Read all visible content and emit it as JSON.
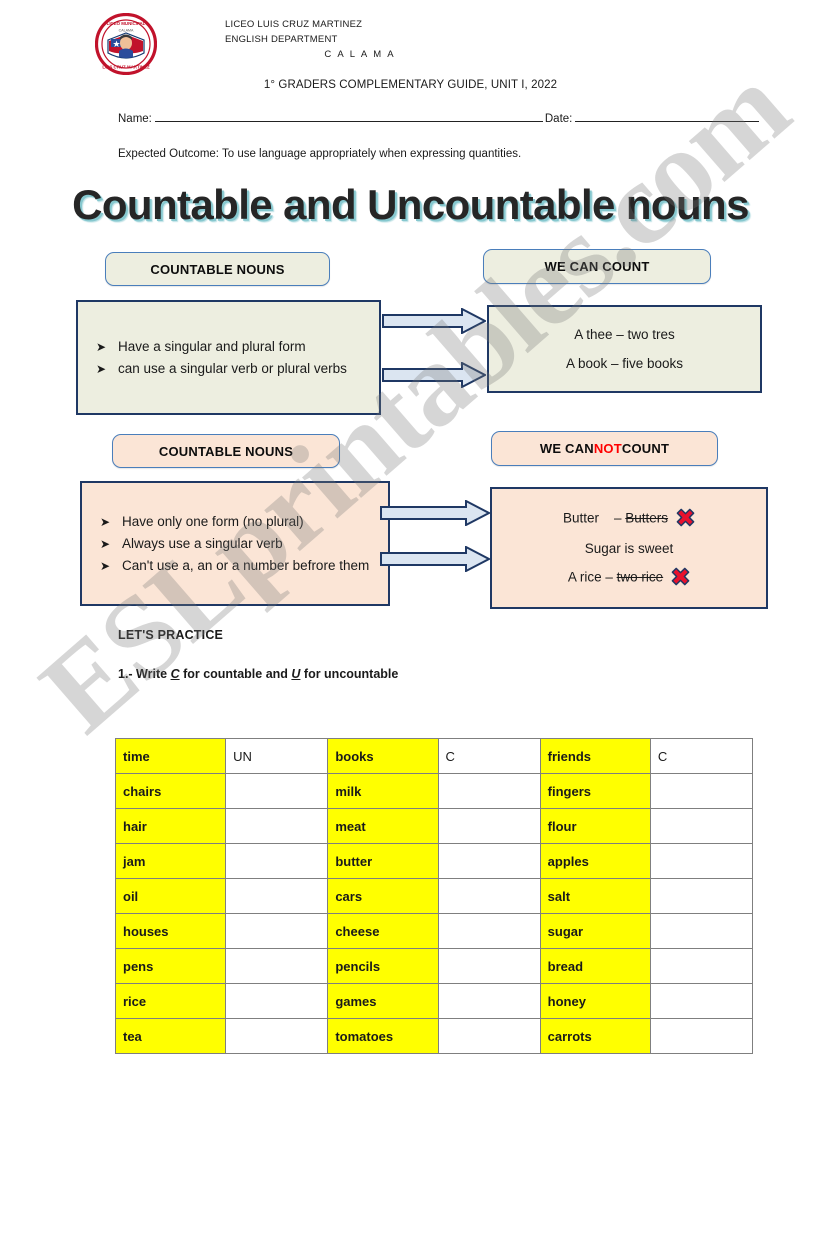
{
  "header": {
    "crest_icon": "school-crest-icon",
    "school_lines": [
      "LICEO LUIS CRUZ MARTINEZ",
      "ENGLISH DEPARTMENT",
      "C A L A M A"
    ],
    "guide_title": "1° GRADERS COMPLEMENTARY GUIDE, UNIT I, 2022",
    "name_label": "Name:",
    "date_label": "Date:",
    "name_value": "",
    "date_value": "",
    "expected_outcome": "Expected Outcome: To use language appropriately when expressing quantities."
  },
  "main_title": "Countable and Uncountable nouns",
  "diagram": {
    "row1": {
      "left_pill": "COUNTABLE NOUNS",
      "left_bullets": [
        "Have a singular and plural form",
        "can use a singular verb or plural verbs"
      ],
      "right_pill": "WE CAN COUNT",
      "right_lines": [
        "A thee – two tres",
        "A book – five books"
      ],
      "arrow_icon": "right-arrow-icon"
    },
    "row2": {
      "left_pill": "COUNTABLE NOUNS",
      "left_bullets": [
        "Have only one form (no plural)",
        "Always use a singular verb",
        "Can't use a, an or a number befrore them"
      ],
      "right_pill_pre": "WE CAN ",
      "right_pill_emphasis": "NOT",
      "right_pill_post": " COUNT",
      "right_line1_ok": "Butter",
      "right_line1_dash": "–",
      "right_line1_struck": "Butters",
      "right_line2": "Sugar is sweet",
      "right_line3_ok": "A rice –",
      "right_line3_struck": "two rice",
      "x_icon": "red-x-icon",
      "arrow_icon": "right-arrow-icon"
    }
  },
  "practice": {
    "heading": "LET'S PRACTICE",
    "instruction_pre": "1.- Write ",
    "instruction_c": "C",
    "instruction_mid": " for countable and ",
    "instruction_u": "U",
    "instruction_post": " for uncountable"
  },
  "table": {
    "rows": [
      {
        "w1": "time",
        "a1": "UN",
        "w2": "books",
        "a2": "C",
        "w3": "friends",
        "a3": "C"
      },
      {
        "w1": "chairs",
        "a1": "",
        "w2": "milk",
        "a2": "",
        "w3": "fingers",
        "a3": ""
      },
      {
        "w1": "hair",
        "a1": "",
        "w2": " meat",
        "a2": "",
        "w3": "flour",
        "a3": ""
      },
      {
        "w1": "jam",
        "a1": "",
        "w2": "butter",
        "a2": "",
        "w3": "apples",
        "a3": ""
      },
      {
        "w1": "oil",
        "a1": "",
        "w2": "cars",
        "a2": "",
        "w3": "salt",
        "a3": ""
      },
      {
        "w1": "houses",
        "a1": "",
        "w2": "cheese",
        "a2": "",
        "w3": "sugar",
        "a3": ""
      },
      {
        "w1": "pens",
        "a1": "",
        "w2": "pencils",
        "a2": "",
        "w3": "bread",
        "a3": ""
      },
      {
        "w1": "rice",
        "a1": "",
        "w2": "games",
        "a2": "",
        "w3": "honey",
        "a3": ""
      },
      {
        "w1": "tea",
        "a1": "",
        "w2": "tomatoes",
        "a2": "",
        "w3": "carrots",
        "a3": ""
      }
    ]
  },
  "watermark": {
    "text": "ESLprintables.com"
  },
  "colors": {
    "highlight_yellow": "#ffff00",
    "beige": "#edeee0",
    "peach": "#fbe5d6",
    "panel_border": "#1f3864",
    "pill_border": "#4a7ebb",
    "title_shadow": "#86c8cf",
    "red": "#ff0000"
  }
}
